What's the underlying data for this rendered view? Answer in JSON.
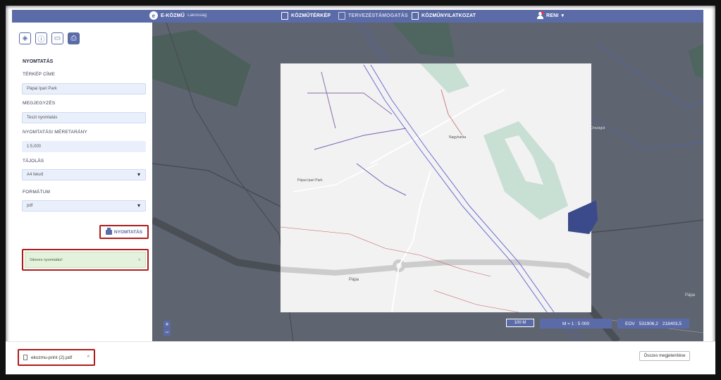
{
  "header": {
    "brand": "E-KÖZMŰ",
    "brand_sub": "Lakosság",
    "nav": [
      "KÖZMŰTÉRKÉP",
      "TERVEZÉSTÁMOGATÁS",
      "KÖZMŰNYILATKOZAT"
    ],
    "user": "RENI"
  },
  "sidebar": {
    "section_title": "NYOMTATÁS",
    "map_title_label": "TÉRKÉP CÍME",
    "map_title_value": "Pápai Ipari Park",
    "note_label": "MEGJEGYZÉS",
    "note_value": "Teszt nyomtatás",
    "scale_label": "NYOMTATÁSI MÉRETARÁNY",
    "scale_value": "1:5,000",
    "orientation_label": "TÁJOLÁS",
    "orientation_value": "A4 fekvő",
    "format_label": "FORMÁTUM",
    "format_value": "pdf",
    "print_button": "NYOMTATÁS",
    "success_message": "Sikeres nyomtatás!"
  },
  "map": {
    "labels": {
      "park": "Pápai Ipari Park",
      "papa": "Pápa",
      "nagyhanta": "Nagyhanta",
      "papa_right": "Pápa",
      "orszagut": "Országút"
    },
    "zoom_in": "+",
    "zoom_out": "−",
    "scale_bar": "100 M",
    "scale_ratio": "M = 1 : 5 000",
    "coord_prefix": "EOV",
    "coord_x": "531906,2",
    "coord_y": "218403,5"
  },
  "downloads": {
    "file_name": "ekozmu-print (2).pdf",
    "show_all": "Összes megjelenítése"
  },
  "colors": {
    "accent": "#5b6ba8",
    "highlight": "#b01c1c",
    "success_bg": "#e3f1dd"
  }
}
